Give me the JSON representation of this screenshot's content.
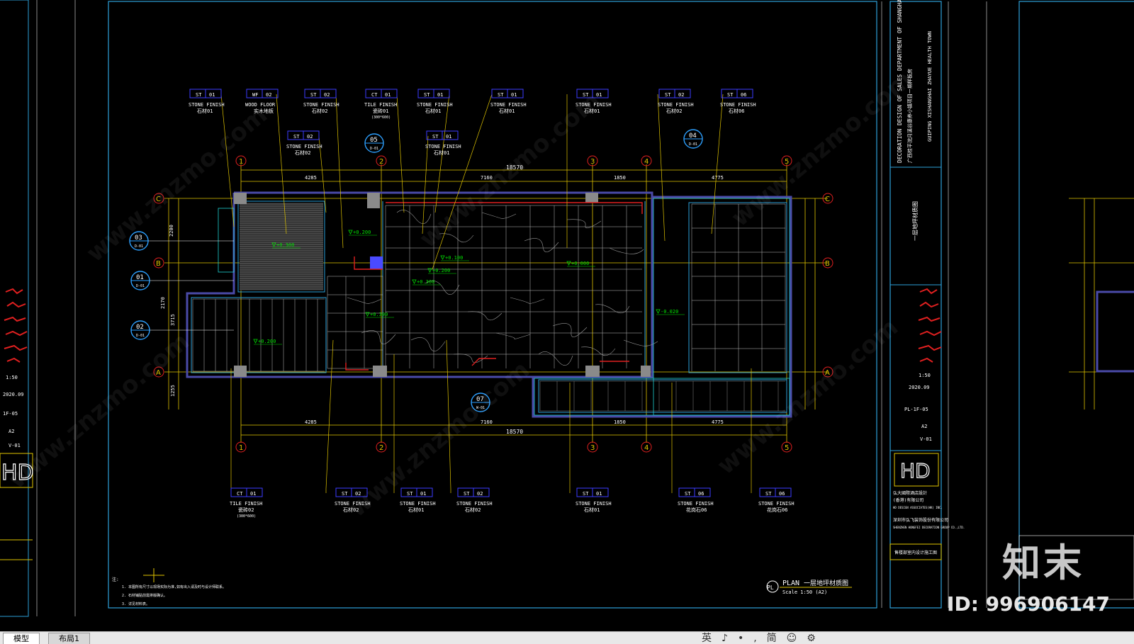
{
  "app": {
    "window_title": ""
  },
  "drawing": {
    "plan_label": "PLAN",
    "plan_title_cn": "一层地坪材质图",
    "plan_scale": "Scale 1:50 (A2)",
    "plan_badge": "PL",
    "overall_dim": "18570",
    "dims_top": [
      "4285",
      "7160",
      "1850",
      "4775"
    ],
    "dims_bottom": [
      "4285",
      "7160",
      "1850",
      "4775"
    ],
    "overall_dim_bottom": "18570",
    "dims_left": [
      "2200",
      "2170",
      "3715",
      "1255"
    ],
    "grid_cols": [
      "1",
      "2",
      "3",
      "4",
      "5"
    ],
    "grid_rows": [
      "C",
      "B",
      "A"
    ],
    "section_markers": [
      {
        "num": "03",
        "sheet": "D-01"
      },
      {
        "num": "01",
        "sheet": "D-01"
      },
      {
        "num": "02",
        "sheet": "D-01"
      },
      {
        "num": "05",
        "sheet": "D-01"
      },
      {
        "num": "04",
        "sheet": "D-01"
      },
      {
        "num": "07",
        "sheet": "W-01"
      }
    ],
    "tags_top": [
      {
        "code": "ST",
        "num": "01",
        "en": "STONE FINISH",
        "cn": "石材01"
      },
      {
        "code": "WF",
        "num": "02",
        "en": "WOOD FLOOR",
        "cn": "实木地板"
      },
      {
        "code": "ST",
        "num": "02",
        "en": "STONE FINISH",
        "cn": "石材02"
      },
      {
        "code": "CT",
        "num": "01",
        "en": "TILE FINISH",
        "cn": "瓷砖01",
        "note": "(300*600)"
      },
      {
        "code": "ST",
        "num": "01",
        "en": "STONE FINISH",
        "cn": "石材01"
      },
      {
        "code": "ST",
        "num": "01",
        "en": "STONE FINISH",
        "cn": "石材01"
      },
      {
        "code": "ST",
        "num": "01",
        "en": "STONE FINISH",
        "cn": "石材01"
      },
      {
        "code": "ST",
        "num": "02",
        "en": "STONE FINISH",
        "cn": "石材02"
      },
      {
        "code": "ST",
        "num": "06",
        "en": "STONE FINISH",
        "cn": "石材06"
      }
    ],
    "tags_mid": [
      {
        "code": "ST",
        "num": "02",
        "en": "STONE FINISH",
        "cn": "石材02"
      },
      {
        "code": "ST",
        "num": "01",
        "en": "STONE FINISH",
        "cn": "石材01"
      }
    ],
    "tags_bottom": [
      {
        "code": "CT",
        "num": "01",
        "en": "TILE FINISH",
        "cn": "瓷砖02",
        "note": "(300*600)"
      },
      {
        "code": "ST",
        "num": "02",
        "en": "STONE FINISH",
        "cn": "石材02"
      },
      {
        "code": "ST",
        "num": "01",
        "en": "STONE FINISH",
        "cn": "石材01"
      },
      {
        "code": "ST",
        "num": "02",
        "en": "STONE FINISH",
        "cn": "石材02"
      },
      {
        "code": "ST",
        "num": "01",
        "en": "STONE FINISH",
        "cn": "石材01"
      },
      {
        "code": "ST",
        "num": "06",
        "en": "STONE FINISH",
        "cn": "花岗石06"
      },
      {
        "code": "ST",
        "num": "06",
        "en": "STONE FINISH",
        "cn": "花岗石06"
      }
    ],
    "levels": [
      "+0.300",
      "+0.200",
      "+0.100",
      "+0.200",
      "+0.300",
      "+0.300",
      "+0.000",
      "+0.200",
      "-0.020"
    ],
    "notes_title": "注:",
    "notes": [
      "1. 本图所有尺寸以现场实际为准,如有出入请及时与设计师联系。",
      "2. 石材铺贴前需排版确认。",
      "3. 详见材料表。"
    ]
  },
  "title_block": {
    "project_en": "DECORATION DESIGN OF SALES DEPARTMENT OF SHANGHAIWAN PROJECT",
    "project_cn": "广西桂平浣月溪谷康养小镇项目一期样板房",
    "town_en": "GUIPING XISHANGHAI ZHAYUE HEALTH TOWN",
    "sheet_title_cn": "一层地坪材质图",
    "scale": "1:50",
    "date": "2020.09",
    "sheet_no": "PL-1F-05",
    "size": "A2",
    "version": "V-01",
    "company_logo": "HD",
    "company_cn": "弘大國際酒店設計",
    "company_cn2": "(香港)有限公司",
    "company_en": "HD DESIGN ASSOCIATES(HK) INC.",
    "company2_cn": "深圳市弘飞装饰股份有限公司",
    "company2_en": "SHENZHEN HONGFEI DECORATION GROUP CO.,LTD.",
    "footer_cn": "售楼部室内设计施工图",
    "left_sheet_no": "1F-05",
    "left_date": "2020.09",
    "left_version": "V-01",
    "left_scale": "1:50",
    "left_size": "A2"
  },
  "overlay": {
    "watermark": "www.znzmo.com",
    "watermark_cn": "知末网",
    "brand": "知末",
    "image_id": "ID: 996906147"
  },
  "layout_tabs": [
    {
      "label": "模型",
      "active": true
    },
    {
      "label": "布局1",
      "active": false
    }
  ],
  "ime_toolbar": [
    "英",
    "♪",
    "•,",
    "简",
    "☺",
    "⚙"
  ],
  "colors": {
    "background": "#000000",
    "frame": "#2da0d9",
    "wall": "#4a4aa8",
    "dim": "#e0c400",
    "level": "#00e000",
    "red": "#e02020",
    "tag_box": "#3c3cff",
    "text": "#ffffff"
  }
}
